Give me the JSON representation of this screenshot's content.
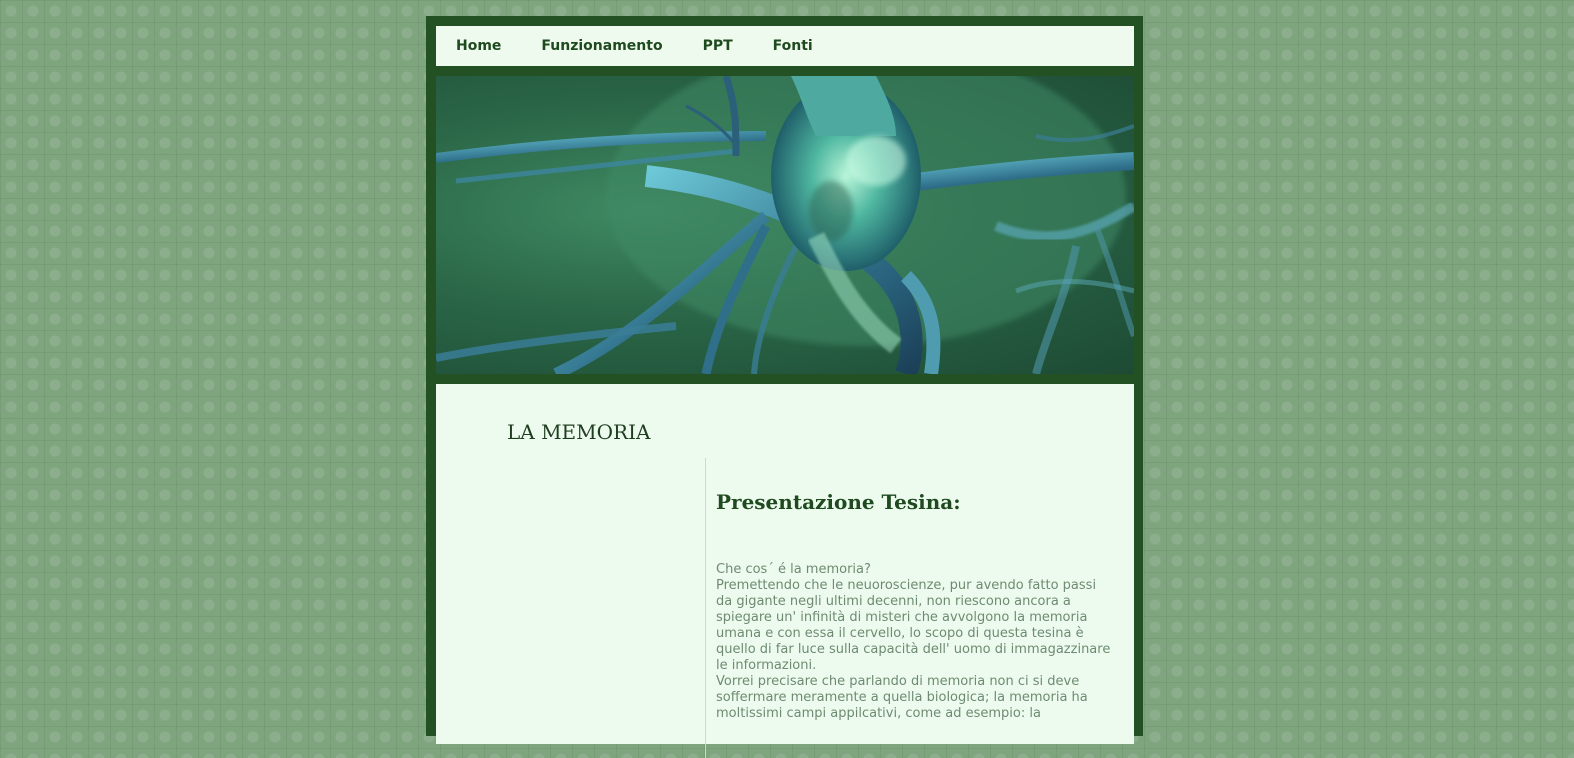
{
  "nav": {
    "items": [
      {
        "label": "Home"
      },
      {
        "label": "Funzionamento"
      },
      {
        "label": "PPT"
      },
      {
        "label": "Fonti"
      }
    ]
  },
  "banner": {
    "subject": "neuron-image"
  },
  "content": {
    "site_title": "LA MEMORIA",
    "section_heading": "Presentazione Tesina:",
    "paragraph": "Che cos´ é la memoria?\nPremettendo che le neuoroscienze, pur avendo fatto passi da gigante negli ultimi decenni, non riescono ancora a spiegare un' infinità di misteri che avvolgono la memoria umana e con essa il cervello, lo scopo di questa tesina è quello di far luce sulla capacità dell' uomo di immagazzinare le informazioni.\nVorrei precisare che parlando di memoria non ci si deve soffermare meramente a quella biologica; la memoria ha moltissimi campi appilcativi, come ad esempio: la"
  },
  "colors": {
    "frame": "#245124",
    "panel": "#edfbee",
    "page_bg": "#7fa57f",
    "text": "#6e8b72",
    "heading": "#1f4a1f"
  }
}
